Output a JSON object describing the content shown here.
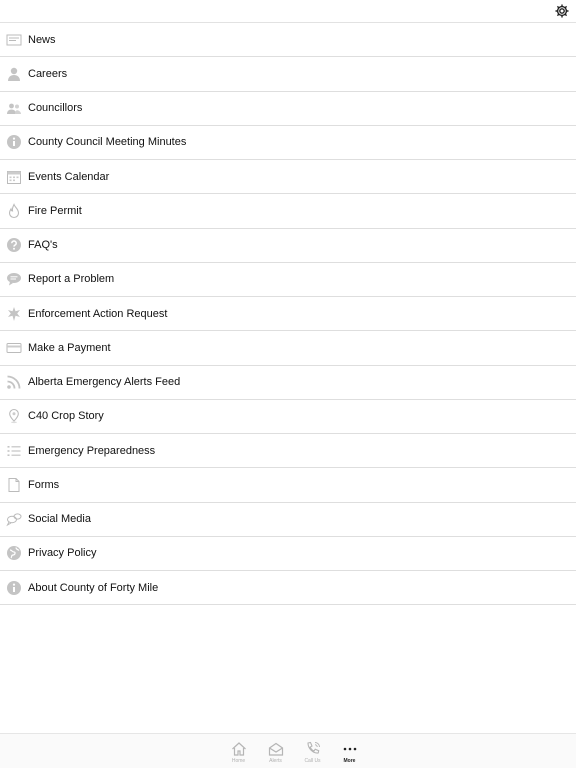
{
  "header": {
    "settings_icon": "gear-icon"
  },
  "menu": {
    "items": [
      {
        "label": "News",
        "icon": "newspaper-icon"
      },
      {
        "label": "Careers",
        "icon": "person-icon"
      },
      {
        "label": "Councillors",
        "icon": "people-icon"
      },
      {
        "label": "County Council Meeting Minutes",
        "icon": "info-icon"
      },
      {
        "label": "Events Calendar",
        "icon": "calendar-icon"
      },
      {
        "label": "Fire Permit",
        "icon": "flame-icon"
      },
      {
        "label": "FAQ's",
        "icon": "question-icon"
      },
      {
        "label": "Report a Problem",
        "icon": "speech-bubble-icon"
      },
      {
        "label": "Enforcement Action Request",
        "icon": "badge-star-icon"
      },
      {
        "label": "Make a Payment",
        "icon": "credit-card-icon"
      },
      {
        "label": "Alberta Emergency Alerts Feed",
        "icon": "rss-icon"
      },
      {
        "label": "C40 Crop Story",
        "icon": "map-pin-icon"
      },
      {
        "label": "Emergency Preparedness",
        "icon": "list-icon"
      },
      {
        "label": "Forms",
        "icon": "document-icon"
      },
      {
        "label": "Social Media",
        "icon": "chat-bubbles-icon"
      },
      {
        "label": "Privacy Policy",
        "icon": "globe-icon"
      },
      {
        "label": "About County of Forty Mile",
        "icon": "info-icon"
      }
    ]
  },
  "tabbar": {
    "tabs": [
      {
        "label": "Home",
        "icon": "home-icon"
      },
      {
        "label": "Alerts",
        "icon": "envelope-icon"
      },
      {
        "label": "Call Us",
        "icon": "phone-icon"
      },
      {
        "label": "More",
        "icon": "more-dots-icon",
        "active": true
      }
    ]
  }
}
